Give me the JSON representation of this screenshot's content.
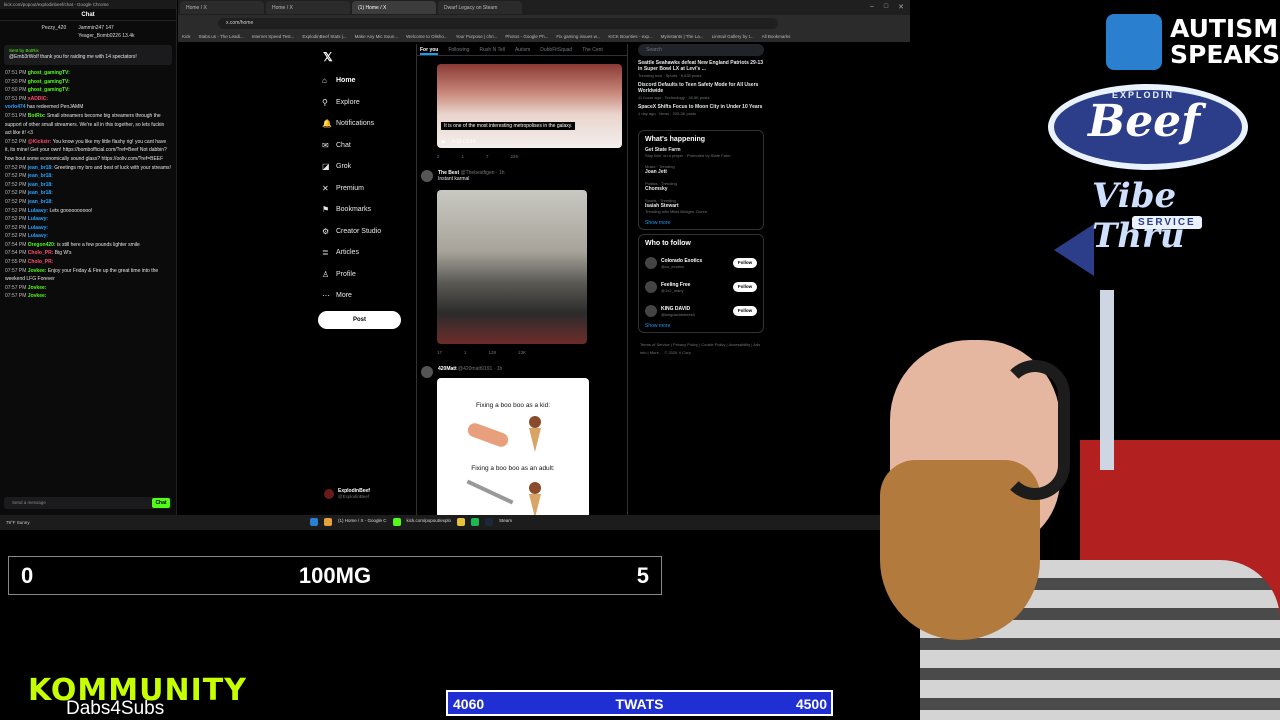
{
  "browser": {
    "tabs": [
      "Home / X",
      "Home / X",
      "(1) Home / X",
      "Dwarf Legacy on Steam"
    ],
    "active_tab_index": 2,
    "address": "x.com/home",
    "window_title": "kick.com/popout/explodinbeef/chat - Google Chrome",
    "bookmarks": [
      "Kick",
      "Stabs.us - The Leadi...",
      "Internet Speed Test...",
      "ExplodinBeef Stats |...",
      "Make Any Mic Soun...",
      "Welcome to Oilsho...",
      "Your Purpose | chri...",
      "Photos - Google Ph...",
      "Fix gaming issues w...",
      "KICK Bounties - exp...",
      "Myinstants | The La...",
      "Linmail Gallery by t..."
    ],
    "bookmarks_right": "All Bookmarks"
  },
  "chat": {
    "title": "Chat",
    "leaders": [
      {
        "name": "Pezzy_420",
        "count": ""
      },
      {
        "name": "Jammin247",
        "count": "147"
      },
      {
        "name": "Yeager_Bomb0226",
        "count": "13.4k"
      }
    ],
    "pinned": {
      "who": "Sent by BotRix",
      "text": "@Emb3rWolf thank you for raiding me with 14 spectators!"
    },
    "messages": [
      {
        "ts": "07:51 PM",
        "user": "ghost_gamingTV:",
        "color": "#53fc18",
        "text": ""
      },
      {
        "ts": "07:50 PM",
        "user": "ghost_gamingTV:",
        "color": "#53fc18",
        "text": ""
      },
      {
        "ts": "07:50 PM",
        "user": "ghost_gamingTV:",
        "color": "#53fc18",
        "text": ""
      },
      {
        "ts": "07:51 PM",
        "user": "xADDIC:",
        "color": "#ff4d6d",
        "text": ""
      },
      {
        "ts": "",
        "user": "vorlo474",
        "color": "#2aa3ff",
        "text": "has redeemed PenJAMM"
      },
      {
        "ts": "07:51 PM",
        "user": "BotRix:",
        "color": "#53fc18",
        "text": "Small streamers become big streamers through the support of other small streamers. We're all in this together, so lets fuckin act like it! <3"
      },
      {
        "ts": "07:52 PM",
        "user": "@Kickstr:",
        "color": "#ff4d6d",
        "text": "You know you like my little flashy rig! you cant have it, its mine! Get your own! https://bombofficial.com/?ref=Beef Not dabbin? how bout some economically sound glass? https://ooliv.com/?ref=BEEF"
      },
      {
        "ts": "07:52 PM",
        "user": "jean_br18:",
        "color": "#2aa3ff",
        "text": "Greetings my bro and best of luck with your streams!"
      },
      {
        "ts": "07:52 PM",
        "user": "jean_br18:",
        "color": "#2aa3ff",
        "text": ""
      },
      {
        "ts": "07:52 PM",
        "user": "jean_br18:",
        "color": "#2aa3ff",
        "text": ""
      },
      {
        "ts": "07:52 PM",
        "user": "jean_br18:",
        "color": "#2aa3ff",
        "text": ""
      },
      {
        "ts": "07:52 PM",
        "user": "jean_br18:",
        "color": "#2aa3ff",
        "text": ""
      },
      {
        "ts": "07:52 PM",
        "user": "Lulaavy:",
        "color": "#2aa3ff",
        "text": "Lets goooooooooo!"
      },
      {
        "ts": "07:52 PM",
        "user": "Lulaavy:",
        "color": "#2aa3ff",
        "text": ""
      },
      {
        "ts": "07:52 PM",
        "user": "Lulaavy:",
        "color": "#2aa3ff",
        "text": ""
      },
      {
        "ts": "07:52 PM",
        "user": "Lulaavy:",
        "color": "#2aa3ff",
        "text": ""
      },
      {
        "ts": "07:54 PM",
        "user": "Oregon420:",
        "color": "#53fc18",
        "text": "is still here a few pounds lighter smile"
      },
      {
        "ts": "07:54 PM",
        "user": "Cholo_PR:",
        "color": "#ff4d6d",
        "text": "Big W's"
      },
      {
        "ts": "07:55 PM",
        "user": "Cholo_PR:",
        "color": "#ff4d6d",
        "text": ""
      },
      {
        "ts": "07:57 PM",
        "user": "Jovkee:",
        "color": "#53fc18",
        "text": "Enjoy your Friday & Fire up the great time into the weekend LFG Forever"
      },
      {
        "ts": "07:57 PM",
        "user": "Jovkee:",
        "color": "#53fc18",
        "text": ""
      },
      {
        "ts": "07:57 PM",
        "user": "Jovkee:",
        "color": "#53fc18",
        "text": ""
      }
    ],
    "input_placeholder": "Send a message",
    "send_label": "Chat"
  },
  "x": {
    "nav": [
      {
        "label": "Home",
        "icon": "home-icon",
        "glyph": "⌂"
      },
      {
        "label": "Explore",
        "icon": "search-icon",
        "glyph": "⚲"
      },
      {
        "label": "Notifications",
        "icon": "bell-icon",
        "glyph": "🔔"
      },
      {
        "label": "Chat",
        "icon": "mail-icon",
        "glyph": "✉"
      },
      {
        "label": "Grok",
        "icon": "grok-icon",
        "glyph": "◪"
      },
      {
        "label": "Premium",
        "icon": "x-icon",
        "glyph": "✕"
      },
      {
        "label": "Bookmarks",
        "icon": "bookmark-icon",
        "glyph": "⚑"
      },
      {
        "label": "Creator Studio",
        "icon": "creator-icon",
        "glyph": "⚙"
      },
      {
        "label": "Articles",
        "icon": "articles-icon",
        "glyph": "≣"
      },
      {
        "label": "Profile",
        "icon": "profile-icon",
        "glyph": "♙"
      },
      {
        "label": "More",
        "icon": "more-icon",
        "glyph": "⋯"
      }
    ],
    "post_label": "Post",
    "account": {
      "name": "ExplodinBeef",
      "handle": "@ExplodinBeef"
    },
    "feed_tabs": [
      "For you",
      "Following",
      "Rush N Tell",
      "Autism",
      "DubbFitSquad",
      "The Cent"
    ],
    "tweets": [
      {
        "caption": "It is one of the most interesting metropolises in the galaxy.",
        "time": "0:10 / 0:19",
        "stats": [
          "2",
          "1",
          "7",
          "226"
        ]
      },
      {
        "name": "The Best",
        "handle": "@Thebestfigen · 1h",
        "text": "Instant karmal",
        "stats": [
          "17",
          "1",
          "128",
          "13K"
        ]
      },
      {
        "name": "420Matt",
        "handle": "@420matt9191 · 1h",
        "meme_top": "Fixing a boo boo as a kid:",
        "meme_bottom": "Fixing a boo boo as an adult:"
      }
    ],
    "search_placeholder": "Search",
    "news": [
      {
        "title": "Seattle Seahawks defeat New England Patriots 29-13 in Super Bowl LX at Levi's ...",
        "meta": "Trending now · Sports · 9,635 posts"
      },
      {
        "title": "Discord Defaults to Teen Safety Mode for All Users Worldwide",
        "meta": "11 hours ago · Technology · 28.5K posts"
      },
      {
        "title": "SpaceX Shifts Focus to Moon City in Under 10 Years",
        "meta": "1 day ago · News · 325.3K posts"
      }
    ],
    "whats_happening": {
      "title": "What's happening",
      "trends": [
        {
          "category": "",
          "name": "Get State Farm",
          "sub": "Stop livin' on a prayer · Promoted by State Farm"
        },
        {
          "category": "Music · Trending",
          "name": "Joan Jett",
          "sub": ""
        },
        {
          "category": "Politics · Trending",
          "name": "Chomsky",
          "sub": ""
        },
        {
          "category": "Sports · Trending",
          "name": "Isaiah Stewart",
          "sub": "Trending with Miles Bridges, Duren"
        }
      ],
      "show_more": "Show more"
    },
    "who_to_follow": {
      "title": "Who to follow",
      "accounts": [
        {
          "name": "Colorado Exotics",
          "handle": "@co_exotics",
          "button": "Follow"
        },
        {
          "name": "Feeling Free",
          "handle": "@1x2_many",
          "button": "Follow"
        },
        {
          "name": "KING DAVID",
          "handle": "@kingdavidsheesh",
          "button": "Follow"
        }
      ],
      "show_more": "Show more"
    },
    "footer": "Terms of Service | Privacy Policy | Cookie Policy | Accessibility | Ads info | More ... © 2026 X Corp."
  },
  "taskbar": {
    "weather": "79°F Sunny",
    "items": [
      "(1) Home / X - Google C",
      "kick.com/popout/explo",
      "Steam"
    ]
  },
  "overlays": {
    "score": {
      "left": "0",
      "center": "100MG",
      "right": "5"
    },
    "goal": {
      "left": "4060",
      "label": "TWATS",
      "right": "4500"
    },
    "kommunity": {
      "title": "KOMMUNITY",
      "sub": "Dabs4Subs"
    },
    "autism": {
      "line1": "AUTISM",
      "line2": "SPEAKS"
    },
    "sign": {
      "top": "EXPLODIN",
      "beef": "Beef",
      "vibe": "Vibe Thru",
      "service": "SERVICE"
    }
  }
}
